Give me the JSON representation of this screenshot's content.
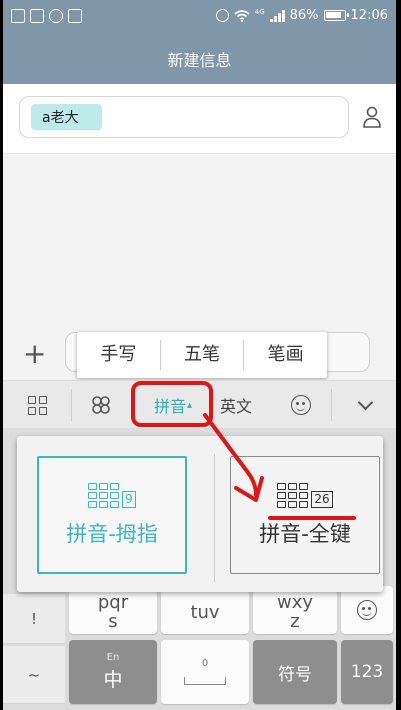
{
  "status_bar": {
    "battery_percent": "86%",
    "time": "12:06",
    "network": "4G"
  },
  "header": {
    "title": "新建信息"
  },
  "recipient": {
    "chip_label": "a老大"
  },
  "compose": {
    "add_glyph": "+"
  },
  "input_method_popup": {
    "options": [
      "手写",
      "五笔",
      "笔画"
    ]
  },
  "keyboard_toolbar": {
    "pinyin_label": "拼音",
    "pinyin_caret": "▴",
    "english_label": "英文"
  },
  "layout_options": [
    {
      "label": "拼音-拇指",
      "badge": "9",
      "selected": true
    },
    {
      "label": "拼音-全键",
      "badge": "26",
      "selected": false
    }
  ],
  "keyboard": {
    "side_keys": [
      "!",
      "~"
    ],
    "row3": [
      {
        "line1": "pqr",
        "line2": "s"
      },
      {
        "line1": "tuv",
        "line2": ""
      },
      {
        "line1": "wxy",
        "line2": "z"
      }
    ],
    "zh_key": {
      "hint": "En",
      "label": "中"
    },
    "space_key": {
      "hint": "0"
    },
    "symbol_key": "符号",
    "num_key": "123"
  },
  "colors": {
    "header_bg": "#7f97a8",
    "accent": "#2ab0b8",
    "annotation_red": "#e01515"
  }
}
